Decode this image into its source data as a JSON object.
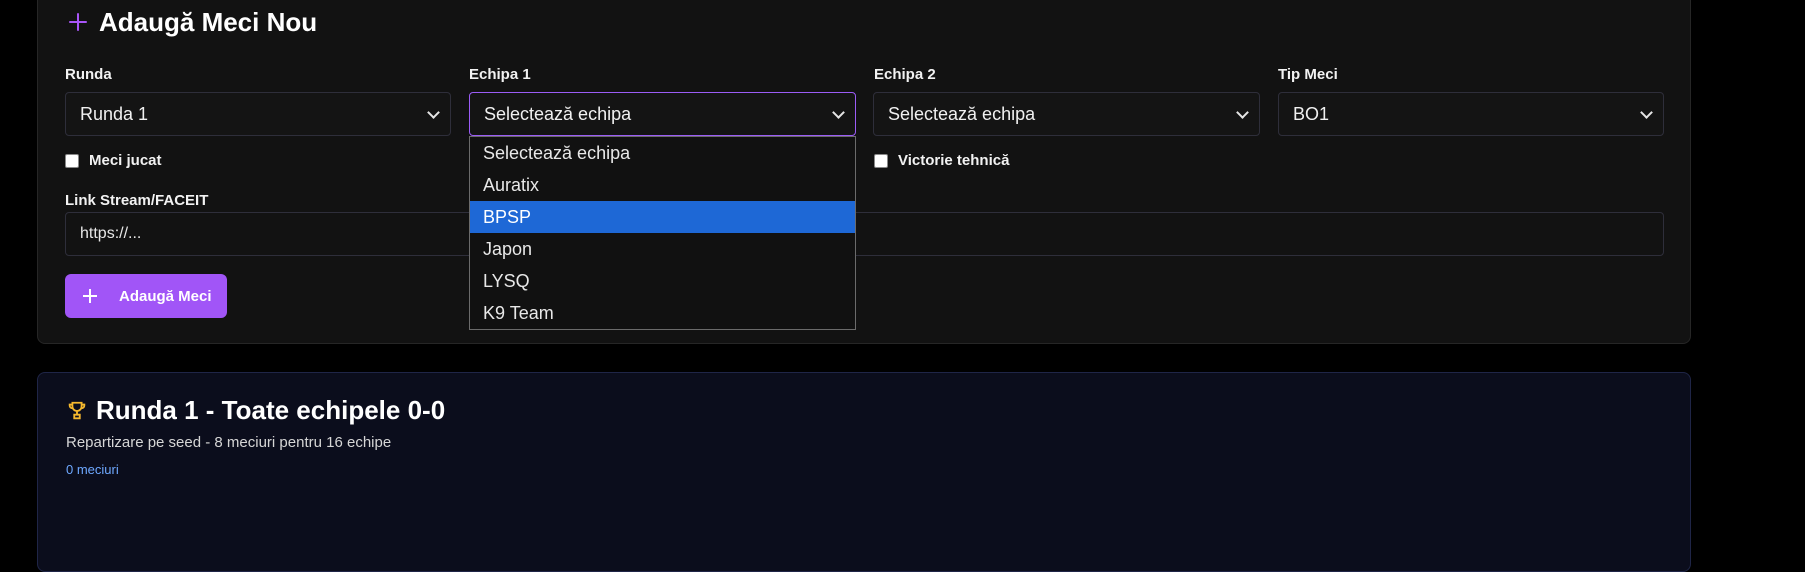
{
  "form": {
    "title": "Adaugă Meci Nou",
    "runda_label": "Runda",
    "runda_value": "Runda 1",
    "team1_label": "Echipa 1",
    "team1_value": "Selectează echipa",
    "team2_label": "Echipa 2",
    "team2_value": "Selectează echipa",
    "type_label": "Tip Meci",
    "type_value": "BO1",
    "played_label": "Meci jucat",
    "tech_win_label": "Victorie tehnică",
    "link_label": "Link Stream/FACEIT",
    "link_placeholder": "https://...",
    "add_button": "Adaugă Meci"
  },
  "dropdown": {
    "options": [
      "Selectează echipa",
      "Auratix",
      "BPSP",
      "Japon",
      "LYSQ",
      "K9 Team"
    ],
    "highlighted": "BPSP"
  },
  "round": {
    "title": "Runda 1 - Toate echipele 0-0",
    "subtitle": "Repartizare pe seed - 8 meciuri pentru 16 echipe",
    "count": "0 meciuri"
  },
  "colors": {
    "accent": "#a855f7",
    "highlight": "#1e68d6",
    "link": "#6ea8ff",
    "trophy": "#f5b82e"
  },
  "icons": [
    "plus-icon",
    "chevron-down-icon",
    "trophy-icon"
  ]
}
